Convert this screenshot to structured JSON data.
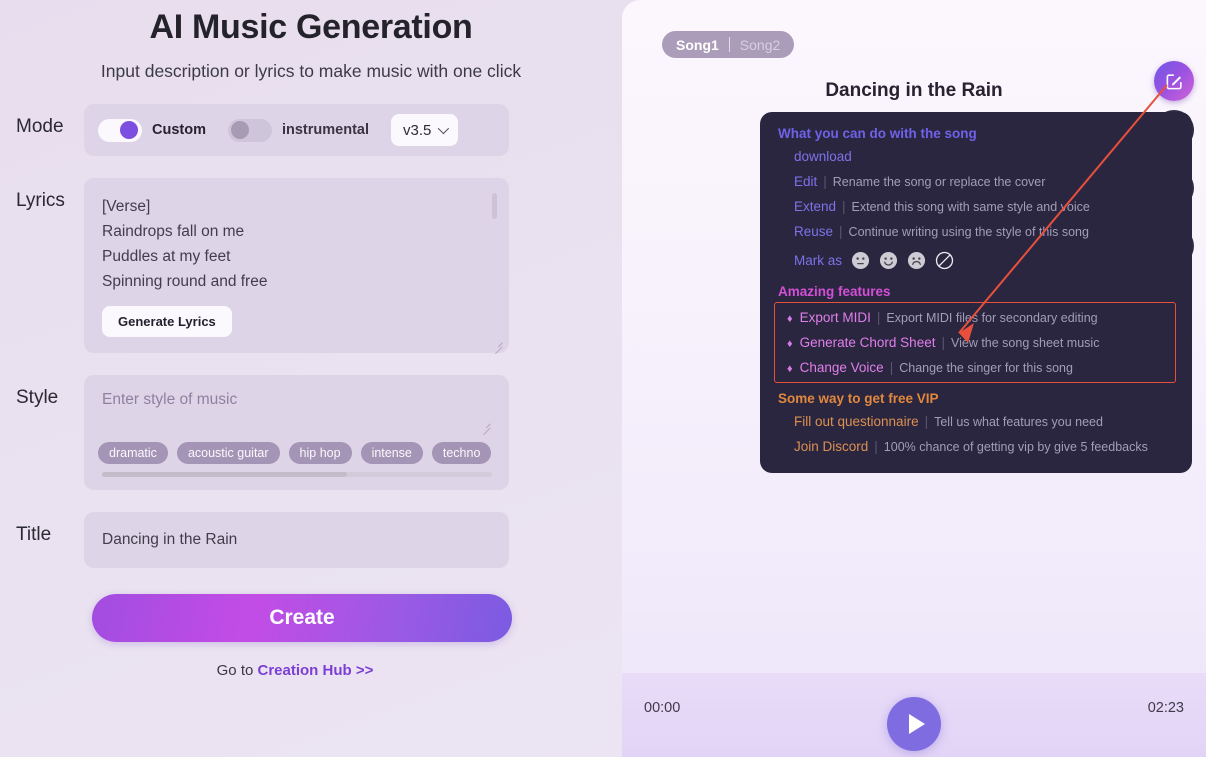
{
  "left": {
    "title": "AI Music Generation",
    "subtitle": "Input description or lyrics to make music with one click",
    "mode": {
      "label": "Mode",
      "custom_label": "Custom",
      "custom_on": true,
      "instrumental_label": "instrumental",
      "instrumental_on": false,
      "version_value": "v3.5",
      "version_icon": "chevron-down-icon"
    },
    "lyrics": {
      "label": "Lyrics",
      "value": "[Verse]\nRaindrops fall on me\nPuddles at my feet\nSpinning round and free",
      "generate_button": "Generate Lyrics"
    },
    "style": {
      "label": "Style",
      "placeholder": "Enter style of music",
      "value": "",
      "tags": [
        "dramatic",
        "acoustic guitar",
        "hip hop",
        "intense",
        "techno"
      ]
    },
    "title_field": {
      "label": "Title",
      "value": "Dancing in the Rain"
    },
    "create_button": "Create",
    "footer": {
      "prefix": "Go to ",
      "link": "Creation Hub",
      "suffix": " >>"
    }
  },
  "right": {
    "tabs": [
      {
        "label": "Song1",
        "active": true
      },
      {
        "label": "Song2",
        "active": false
      }
    ],
    "song_title": "Dancing in the Rain",
    "edit_button_icon": "edit-square-icon",
    "rail_icons": [
      "share-icon",
      "list-icon",
      "refresh-icon"
    ],
    "info_panel": {
      "song_section": {
        "heading": "What you can do with the song",
        "rows": [
          {
            "key": "download",
            "bar": "",
            "desc": ""
          },
          {
            "key": "Edit",
            "bar": "|",
            "desc": "Rename the song or replace the cover"
          },
          {
            "key": "Extend",
            "bar": "|",
            "desc": "Extend this song with same style and voice"
          },
          {
            "key": "Reuse",
            "bar": "|",
            "desc": "Continue writing using the style of this song"
          }
        ],
        "mark_as_label": "Mark as",
        "mark_icons": [
          "neutral-face-icon",
          "happy-face-icon",
          "sad-face-icon",
          "ban-icon"
        ]
      },
      "features_section": {
        "heading": "Amazing features",
        "highlight_color": "#e8503c",
        "rows": [
          {
            "icon": "gem-icon",
            "key": "Export MIDI",
            "bar": "|",
            "desc": "Export MIDI files for secondary editing"
          },
          {
            "icon": "gem-icon",
            "key": "Generate Chord Sheet",
            "bar": "|",
            "desc": "View the song sheet music"
          },
          {
            "icon": "gem-icon",
            "key": "Change Voice",
            "bar": "|",
            "desc": "Change the singer for this song"
          }
        ]
      },
      "vip_section": {
        "heading": "Some way to get free VIP",
        "rows": [
          {
            "key": "Fill out questionnaire",
            "bar": "|",
            "desc": "Tell us what features you need"
          },
          {
            "key": "Join Discord",
            "bar": "|",
            "desc": "100% chance of getting vip by give 5 feedbacks"
          }
        ]
      }
    },
    "player": {
      "current_time": "00:00",
      "total_time": "02:23",
      "play_icon": "play-icon"
    }
  },
  "colors": {
    "accent_purple": "#7c4fe0",
    "accent_magenta": "#d24fd6",
    "accent_orange": "#e1883d",
    "annotation_red": "#e8503c",
    "panel_dark": "#2a2640"
  }
}
